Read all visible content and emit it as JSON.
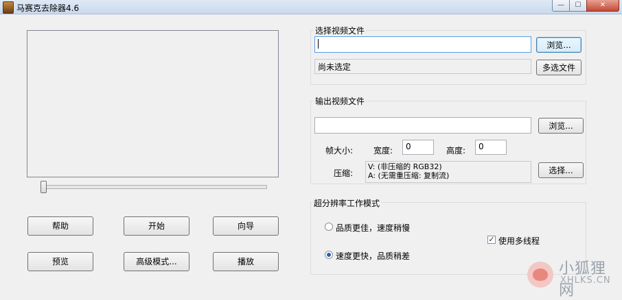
{
  "window": {
    "title": "马赛克去除器4.6",
    "min_glyph": "—",
    "max_glyph": "☐",
    "close_glyph": "✕"
  },
  "left": {
    "buttons": {
      "help": "帮助",
      "start": "开始",
      "wizard": "向导",
      "preview": "预览",
      "advanced": "高级模式...",
      "play": "播放"
    }
  },
  "select_video": {
    "title": "选择视频文件",
    "path_value": "",
    "browse": "浏览...",
    "status": "尚未选定",
    "multi_select": "多选文件"
  },
  "output_video": {
    "title": "输出视频文件",
    "path_value": "",
    "browse": "浏览...",
    "frame_size_label": "帧大小:",
    "width_label": "宽度:",
    "width_value": "0",
    "height_label": "高度:",
    "height_value": "0",
    "compress_label": "压缩:",
    "compress_video": "V: (非压缩的 RGB32)",
    "compress_audio": "A: (无需重压缩: 复制流)",
    "choose": "选择..."
  },
  "superres": {
    "title": "超分辨率工作模式",
    "option_quality": "品质更佳，速度稍慢",
    "option_speed": "速度更快，品质稍差",
    "selected": "option_speed",
    "multithread_label": "使用多线程",
    "multithread_checked": true
  },
  "watermark": {
    "cn": "小狐狸网",
    "en": "XHLKS.CN"
  }
}
